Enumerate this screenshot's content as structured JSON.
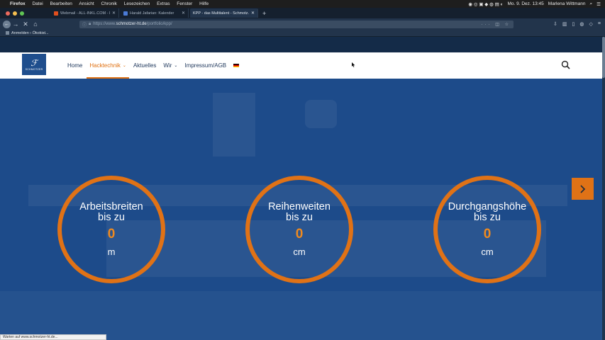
{
  "os_menubar": {
    "apple": "",
    "items": [
      "Firefox",
      "Datei",
      "Bearbeiten",
      "Ansicht",
      "Chronik",
      "Lesezeichen",
      "Extras",
      "Fenster",
      "Hilfe"
    ],
    "clock": "Mo. 9. Dez.  13:45",
    "user": "Marlena Wittmann"
  },
  "browser": {
    "tabs": [
      {
        "title": "Webmail - ALL-INKL.COM - Lo..."
      },
      {
        "title": "Harald Jafarian: Kalender"
      },
      {
        "title": "KPP - das Multitalent - Schmotz..."
      }
    ],
    "url_scheme": "https://www.",
    "url_host": "schmotzer-ht.de",
    "url_path": "/portfolio/kpp/",
    "bookmark": "Anmelden ‹ Ökokist...",
    "status_text": "Warten auf www.schmotzer-ht.de..."
  },
  "site": {
    "logo_text": "SCHMOTZER",
    "nav": [
      {
        "label": "Home",
        "active": false,
        "dropdown": false
      },
      {
        "label": "Hacktechnik",
        "active": true,
        "dropdown": true
      },
      {
        "label": "Aktuelles",
        "active": false,
        "dropdown": false
      },
      {
        "label": "Wir",
        "active": false,
        "dropdown": true
      },
      {
        "label": "Impressum/AGB",
        "active": false,
        "dropdown": false
      }
    ],
    "language_icon": "flag-de-icon",
    "accent": "#e07216",
    "hero_bg": "#1d4b8a"
  },
  "stats": [
    {
      "label_line1": "Arbeitsbreiten",
      "label_line2": "bis zu",
      "value": "0",
      "unit": "m"
    },
    {
      "label_line1": "Reihenweiten",
      "label_line2": "bis zu",
      "value": "0",
      "unit": "cm"
    },
    {
      "label_line1": "Durchgangshöhe",
      "label_line2": "bis zu",
      "value": "0",
      "unit": "cm"
    }
  ]
}
